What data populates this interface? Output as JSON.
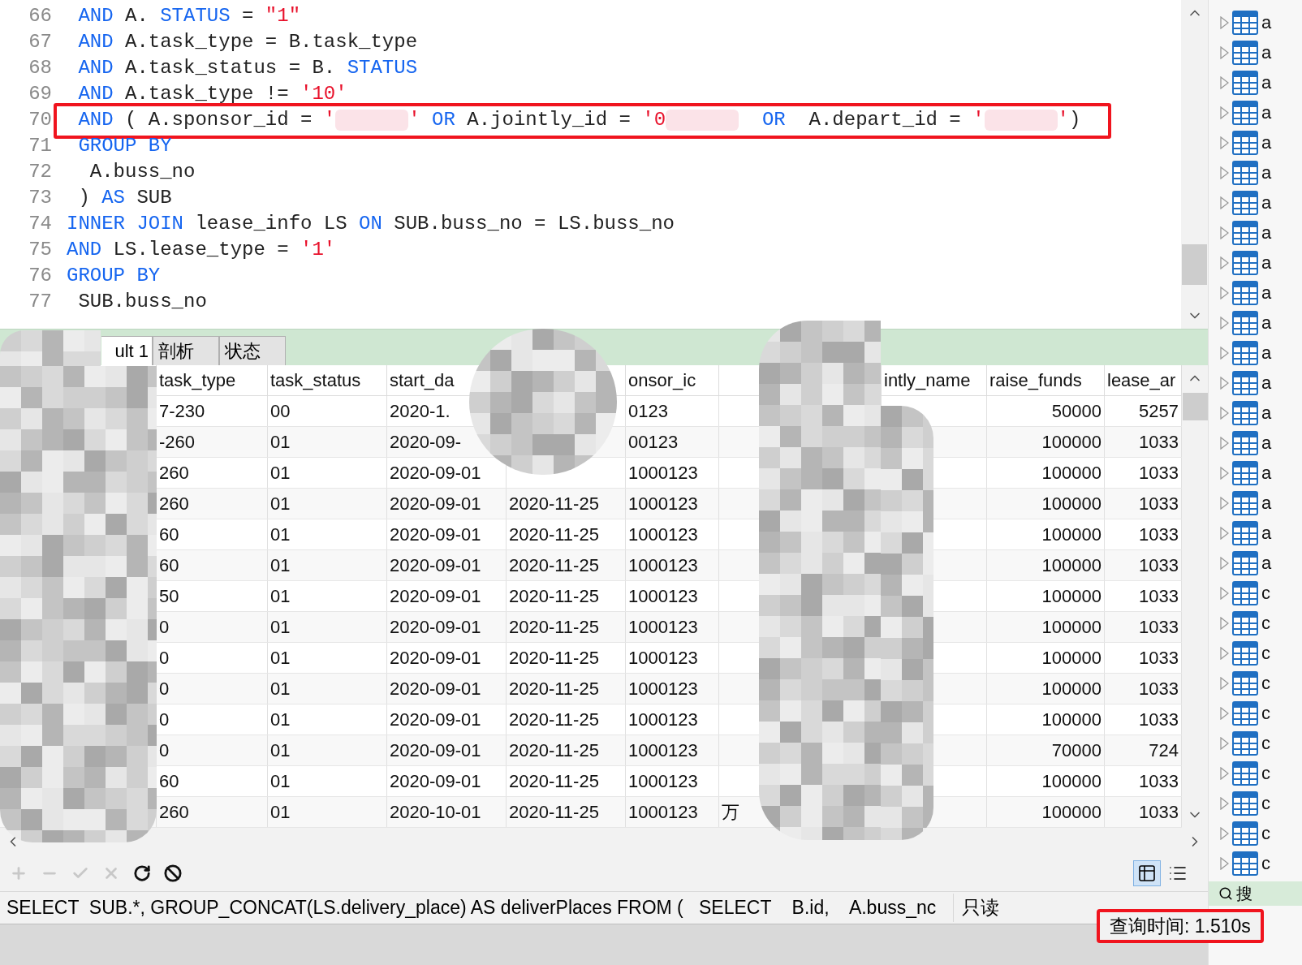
{
  "editor": {
    "lines": [
      {
        "number": "66",
        "tokens": [
          {
            "kind": "keyword",
            "text": " AND"
          },
          {
            "kind": "plain",
            "text": " A. "
          },
          {
            "kind": "keyword",
            "text": "STATUS"
          },
          {
            "kind": "plain",
            "text": " = "
          },
          {
            "kind": "string",
            "text": "\"1\""
          }
        ]
      },
      {
        "number": "67",
        "tokens": [
          {
            "kind": "keyword",
            "text": " AND"
          },
          {
            "kind": "plain",
            "text": " A.task_type = B.task_type"
          }
        ]
      },
      {
        "number": "68",
        "tokens": [
          {
            "kind": "keyword",
            "text": " AND"
          },
          {
            "kind": "plain",
            "text": " A.task_status = B. "
          },
          {
            "kind": "keyword",
            "text": "STATUS"
          }
        ]
      },
      {
        "number": "69",
        "tokens": [
          {
            "kind": "keyword",
            "text": " AND"
          },
          {
            "kind": "plain",
            "text": " A.task_type != "
          },
          {
            "kind": "string",
            "text": "'10'"
          }
        ]
      },
      {
        "number": "70",
        "highlighted": true,
        "tokens": [
          {
            "kind": "keyword",
            "text": " AND"
          },
          {
            "kind": "plain",
            "text": " ( A.sponsor_id = "
          },
          {
            "kind": "string",
            "text": "'"
          },
          {
            "kind": "redacted"
          },
          {
            "kind": "string",
            "text": "'"
          },
          {
            "kind": "space"
          },
          {
            "kind": "keyword",
            "text": "OR"
          },
          {
            "kind": "plain",
            "text": " A.jointly_id = "
          },
          {
            "kind": "string",
            "text": "'0"
          },
          {
            "kind": "redacted"
          },
          {
            "kind": "space"
          },
          {
            "kind": "space"
          },
          {
            "kind": "keyword",
            "text": "OR"
          },
          {
            "kind": "plain",
            "text": "  A.depart_id = "
          },
          {
            "kind": "string",
            "text": "'"
          },
          {
            "kind": "redacted"
          },
          {
            "kind": "string",
            "text": "'"
          },
          {
            "kind": "plain",
            "text": ")"
          }
        ]
      },
      {
        "number": "71",
        "tokens": [
          {
            "kind": "keyword",
            "text": " GROUP BY"
          }
        ]
      },
      {
        "number": "72",
        "tokens": [
          {
            "kind": "plain",
            "text": "  A.buss_no"
          }
        ]
      },
      {
        "number": "73",
        "tokens": [
          {
            "kind": "plain",
            "text": " ) "
          },
          {
            "kind": "keyword",
            "text": "AS"
          },
          {
            "kind": "plain",
            "text": " SUB"
          }
        ]
      },
      {
        "number": "74",
        "tokens": [
          {
            "kind": "keyword",
            "text": "INNER JOIN"
          },
          {
            "kind": "plain",
            "text": " lease_info LS "
          },
          {
            "kind": "keyword",
            "text": "ON"
          },
          {
            "kind": "plain",
            "text": " SUB.buss_no = LS.buss_no"
          }
        ]
      },
      {
        "number": "75",
        "tokens": [
          {
            "kind": "keyword",
            "text": "AND"
          },
          {
            "kind": "plain",
            "text": " LS.lease_type = "
          },
          {
            "kind": "string",
            "text": "'1'"
          }
        ]
      },
      {
        "number": "76",
        "tokens": [
          {
            "kind": "keyword",
            "text": "GROUP BY"
          }
        ]
      },
      {
        "number": "77",
        "tokens": [
          {
            "kind": "plain",
            "text": " SUB.buss_no"
          }
        ]
      }
    ]
  },
  "result_tabs": [
    {
      "label": "ult 1",
      "selected": true
    },
    {
      "label": "剖析",
      "selected": false
    },
    {
      "label": "状态",
      "selected": false
    }
  ],
  "table": {
    "columns": [
      {
        "header": "task_type"
      },
      {
        "header": "task_status"
      },
      {
        "header": "start_da"
      },
      {},
      {
        "header": "onsor_ic"
      },
      {},
      {
        "header": "intly_name"
      },
      {
        "header": "raise_funds"
      },
      {
        "header": "lease_ar"
      }
    ],
    "rows": [
      [
        "7-230",
        "00",
        "2020-1.",
        null,
        "0123",
        null,
        null,
        "50000",
        "5257"
      ],
      [
        "-260",
        "01",
        "2020-09-",
        null,
        "00123",
        null,
        null,
        "100000",
        "1033"
      ],
      [
        "260",
        "01",
        "2020-09-01",
        null,
        "1000123",
        null,
        null,
        "100000",
        "1033"
      ],
      [
        "260",
        "01",
        "2020-09-01",
        "2020-11-25",
        "1000123",
        null,
        null,
        "100000",
        "1033"
      ],
      [
        "60",
        "01",
        "2020-09-01",
        "2020-11-25",
        "1000123",
        null,
        null,
        "100000",
        "1033"
      ],
      [
        "60",
        "01",
        "2020-09-01",
        "2020-11-25",
        "1000123",
        null,
        null,
        "100000",
        "1033"
      ],
      [
        "50",
        "01",
        "2020-09-01",
        "2020-11-25",
        "1000123",
        null,
        null,
        "100000",
        "1033"
      ],
      [
        "0",
        "01",
        "2020-09-01",
        "2020-11-25",
        "1000123",
        null,
        null,
        "100000",
        "1033"
      ],
      [
        "0",
        "01",
        "2020-09-01",
        "2020-11-25",
        "1000123",
        null,
        null,
        "100000",
        "1033"
      ],
      [
        "0",
        "01",
        "2020-09-01",
        "2020-11-25",
        "1000123",
        null,
        null,
        "100000",
        "1033"
      ],
      [
        "0",
        "01",
        "2020-09-01",
        "2020-11-25",
        "1000123",
        null,
        null,
        "100000",
        "1033"
      ],
      [
        "0",
        "01",
        "2020-09-01",
        "2020-11-25",
        "1000123",
        null,
        null,
        "70000",
        "724"
      ],
      [
        "60",
        "01",
        "2020-09-01",
        "2020-11-25",
        "1000123",
        null,
        null,
        "100000",
        "1033"
      ],
      [
        "260",
        "01",
        "2020-10-01",
        "2020-11-25",
        "1000123",
        "万",
        null,
        "100000",
        "1033"
      ]
    ]
  },
  "toolbar": [
    {
      "kind": "add",
      "disabled": true
    },
    {
      "kind": "remove",
      "disabled": true
    },
    {
      "kind": "apply",
      "disabled": true
    },
    {
      "kind": "discard",
      "disabled": true
    },
    {
      "kind": "refresh",
      "disabled": false
    },
    {
      "kind": "stop",
      "disabled": false
    }
  ],
  "view_buttons": [
    {
      "kind": "grid",
      "selected": true
    },
    {
      "kind": "form",
      "selected": false
    }
  ],
  "status_bar": {
    "sql": "SELECT  SUB.*, GROUP_CONCAT(LS.delivery_place) AS deliverPlaces FROM (   SELECT    B.id,    A.buss_nc",
    "mode": "只读",
    "query_time": "查询时间: 1.510s",
    "query_time_highlighted": true
  },
  "object_tree": {
    "items": [
      {
        "label": "a"
      },
      {
        "label": "a"
      },
      {
        "label": "a"
      },
      {
        "label": "a"
      },
      {
        "label": "a"
      },
      {
        "label": "a"
      },
      {
        "label": "a"
      },
      {
        "label": "a"
      },
      {
        "label": "a"
      },
      {
        "label": "a"
      },
      {
        "label": "a"
      },
      {
        "label": "a"
      },
      {
        "label": "a"
      },
      {
        "label": "a"
      },
      {
        "label": "a"
      },
      {
        "label": "a"
      },
      {
        "label": "a"
      },
      {
        "label": "a"
      },
      {
        "label": "a"
      },
      {
        "label": "c"
      },
      {
        "label": "c"
      },
      {
        "label": "c"
      },
      {
        "label": "c"
      },
      {
        "label": "c"
      },
      {
        "label": "c"
      },
      {
        "label": "c"
      },
      {
        "label": "c"
      },
      {
        "label": "c"
      },
      {
        "label": "c"
      }
    ],
    "search_button": "搜"
  }
}
